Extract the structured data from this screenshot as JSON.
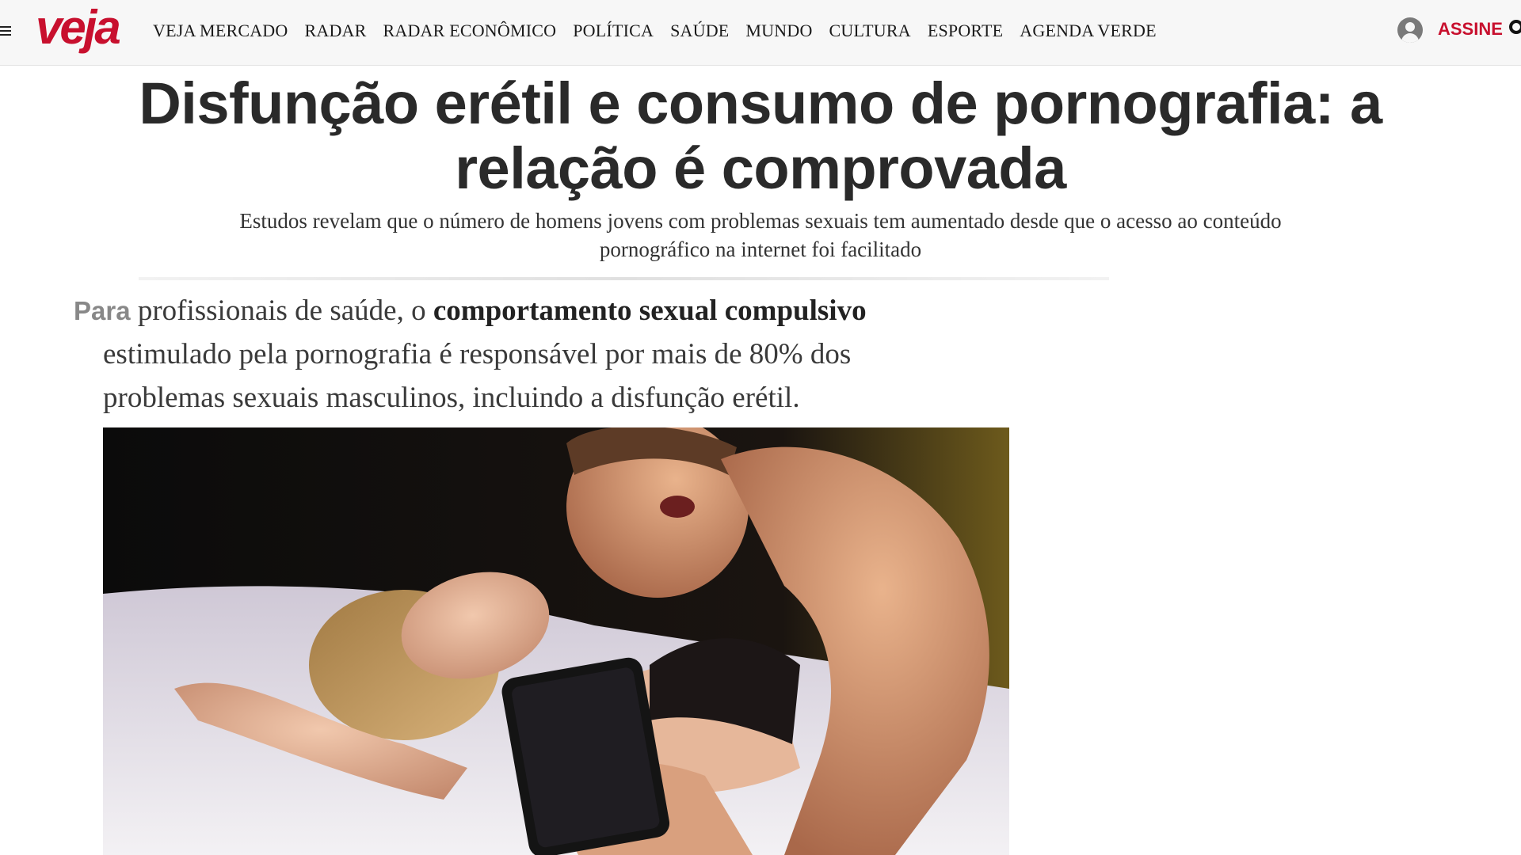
{
  "header": {
    "logo": "veja",
    "nav": [
      "VEJA MERCADO",
      "RADAR",
      "RADAR ECONÔMICO",
      "POLÍTICA",
      "SAÚDE",
      "MUNDO",
      "CULTURA",
      "ESPORTE",
      "AGENDA VERDE"
    ],
    "subscribe_label": "ASSINE",
    "icons": [
      "menu-icon",
      "user-icon",
      "search-icon"
    ]
  },
  "article": {
    "headline": "Disfunção erétil e consumo de pornografia: a relação é comprovada",
    "subtitle": "Estudos revelam que o número de homens jovens com problemas sexuais tem aumentado desde que o acesso ao conteúdo pornográfico na internet foi facilitado",
    "paragraph": {
      "lead": "Para",
      "line1_pre": " profissionais de saúde, o ",
      "line1_bold": "comportamento sexual compulsivo",
      "line2": "estimulado pela pornografia é responsável por mais de 80% dos",
      "line3": "problemas sexuais masculinos, incluindo a disfunção erétil."
    }
  },
  "colors": {
    "brand": "#c8102e",
    "header_bg": "#f7f7f7",
    "headline": "#2a2a2a"
  }
}
